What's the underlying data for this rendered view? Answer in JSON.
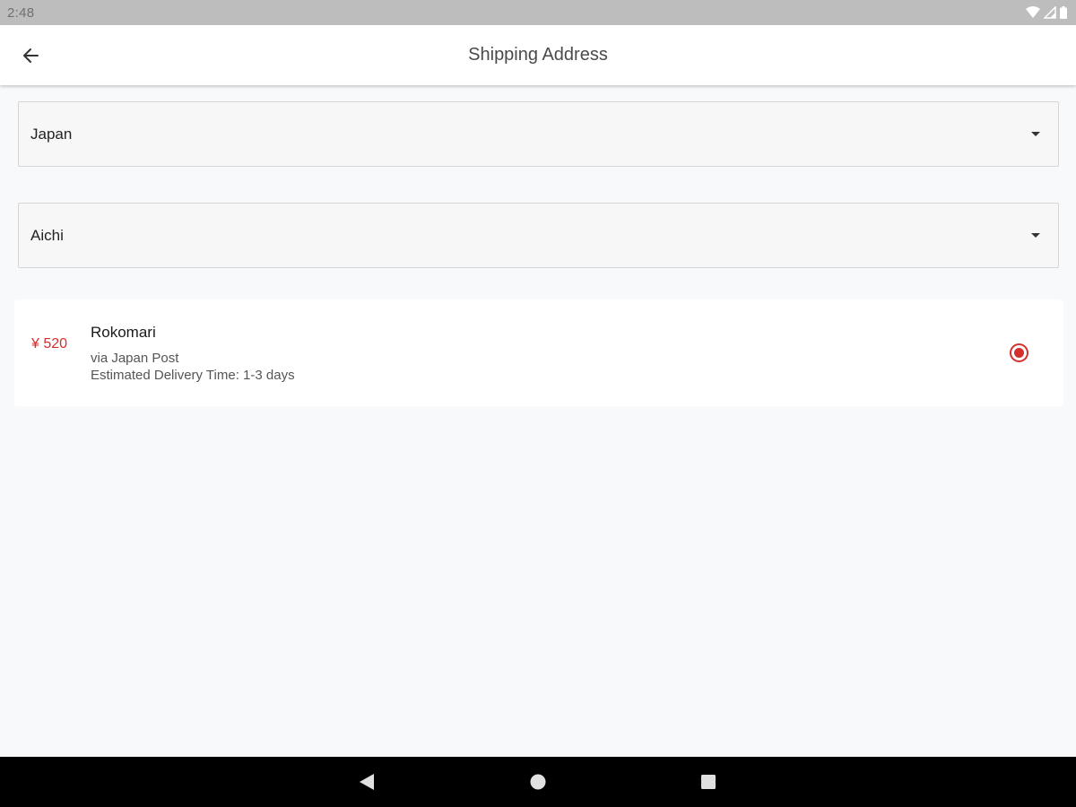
{
  "status_bar": {
    "time": "2:48",
    "icons": [
      "wifi-icon",
      "cell-signal-icon",
      "battery-icon"
    ]
  },
  "app_bar": {
    "title": "Shipping Address",
    "back_icon": "arrow-left-icon"
  },
  "country_select": {
    "selected": "Japan",
    "icon": "caret-down-icon"
  },
  "region_select": {
    "selected": "Aichi",
    "icon": "caret-down-icon"
  },
  "shipping_option": {
    "price": "¥ 520",
    "name": "Rokomari",
    "carrier": "via Japan Post",
    "eta": "Estimated Delivery Time: 1-3 days",
    "selected": true
  },
  "nav_bar": {
    "buttons": [
      "back-triangle-icon",
      "home-circle-icon",
      "recents-square-icon"
    ]
  },
  "colors": {
    "accent": "#d32f2f",
    "background": "#f8f9fb",
    "status_bar": "#bdbdbd",
    "nav_bar": "#000000"
  }
}
